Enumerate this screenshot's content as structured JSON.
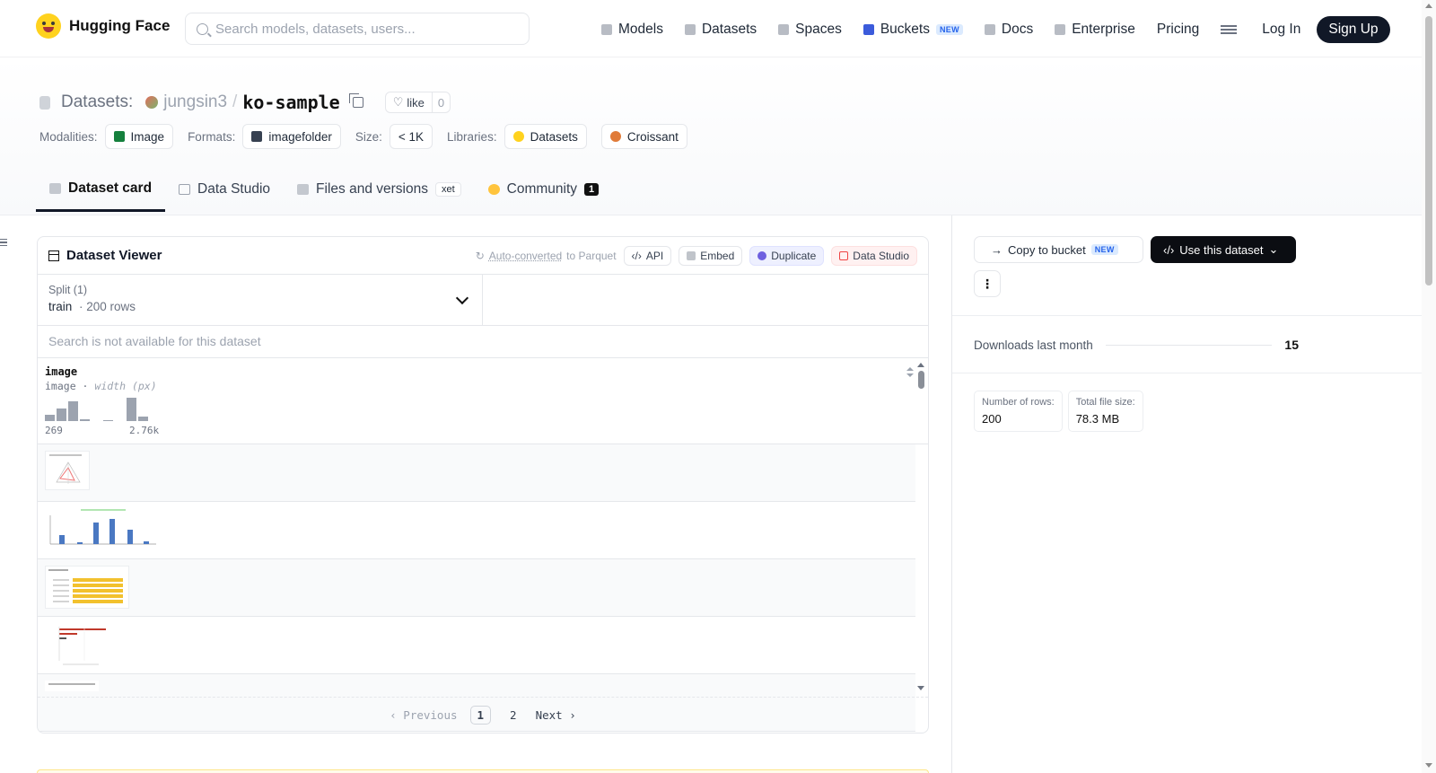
{
  "nav": {
    "brand": "Hugging Face",
    "search_placeholder": "Search models, datasets, users...",
    "links": [
      {
        "label": "Models",
        "icon": "cube-icon"
      },
      {
        "label": "Datasets",
        "icon": "database-icon"
      },
      {
        "label": "Spaces",
        "icon": "spaces-grid-icon"
      },
      {
        "label": "Buckets",
        "icon": "bucket-icon",
        "badge": "NEW"
      },
      {
        "label": "Docs",
        "icon": "book-icon"
      },
      {
        "label": "Enterprise",
        "icon": "enterprise-icon"
      },
      {
        "label": "Pricing"
      }
    ],
    "login": "Log In",
    "signup": "Sign Up"
  },
  "repo": {
    "section": "Datasets:",
    "user": "jungsin3",
    "sep": "/",
    "name": "ko-sample",
    "like_label": "like",
    "like_count": "0"
  },
  "meta": {
    "modalities_label": "Modalities:",
    "modality": "Image",
    "formats_label": "Formats:",
    "format": "imagefolder",
    "size_label": "Size:",
    "size": "< 1K",
    "libraries_label": "Libraries:",
    "libraries": [
      "Datasets",
      "Croissant"
    ]
  },
  "tabs": [
    {
      "label": "Dataset card",
      "active": true
    },
    {
      "label": "Data Studio"
    },
    {
      "label": "Files and versions",
      "badge": "xet"
    },
    {
      "label": "Community",
      "count": "1"
    }
  ],
  "viewer": {
    "title": "Dataset Viewer",
    "auto_converted": "Auto-converted",
    "auto_converted_suffix": "to Parquet",
    "buttons": [
      "API",
      "Embed",
      "Duplicate",
      "Data Studio"
    ],
    "split_label": "Split (1)",
    "split_name": "train",
    "split_rows": "200 rows",
    "search_unavailable": "Search is not available for this dataset",
    "column": {
      "name": "image",
      "type": "image",
      "stat": "width (px)",
      "hist_min": "269",
      "hist_max": "2.76k",
      "hist_values": [
        0.25,
        0.55,
        0.85,
        0.07,
        0,
        0.05,
        0,
        1.0,
        0.2
      ]
    },
    "pager": {
      "prev": "Previous",
      "pages": [
        "1",
        "2"
      ],
      "current": "1",
      "next": "Next"
    }
  },
  "sidebar": {
    "copy_bucket": "Copy to bucket",
    "copy_bucket_badge": "NEW",
    "use_dataset": "Use this dataset",
    "downloads_label": "Downloads last month",
    "downloads_value": "15",
    "rows_label": "Number of rows:",
    "rows_value": "200",
    "size_label": "Total file size:",
    "size_value": "78.3 MB"
  },
  "colors": {
    "accent_dark": "#111827",
    "hf_yellow": "#ffd21e",
    "new_badge_blue": "#2563eb"
  }
}
